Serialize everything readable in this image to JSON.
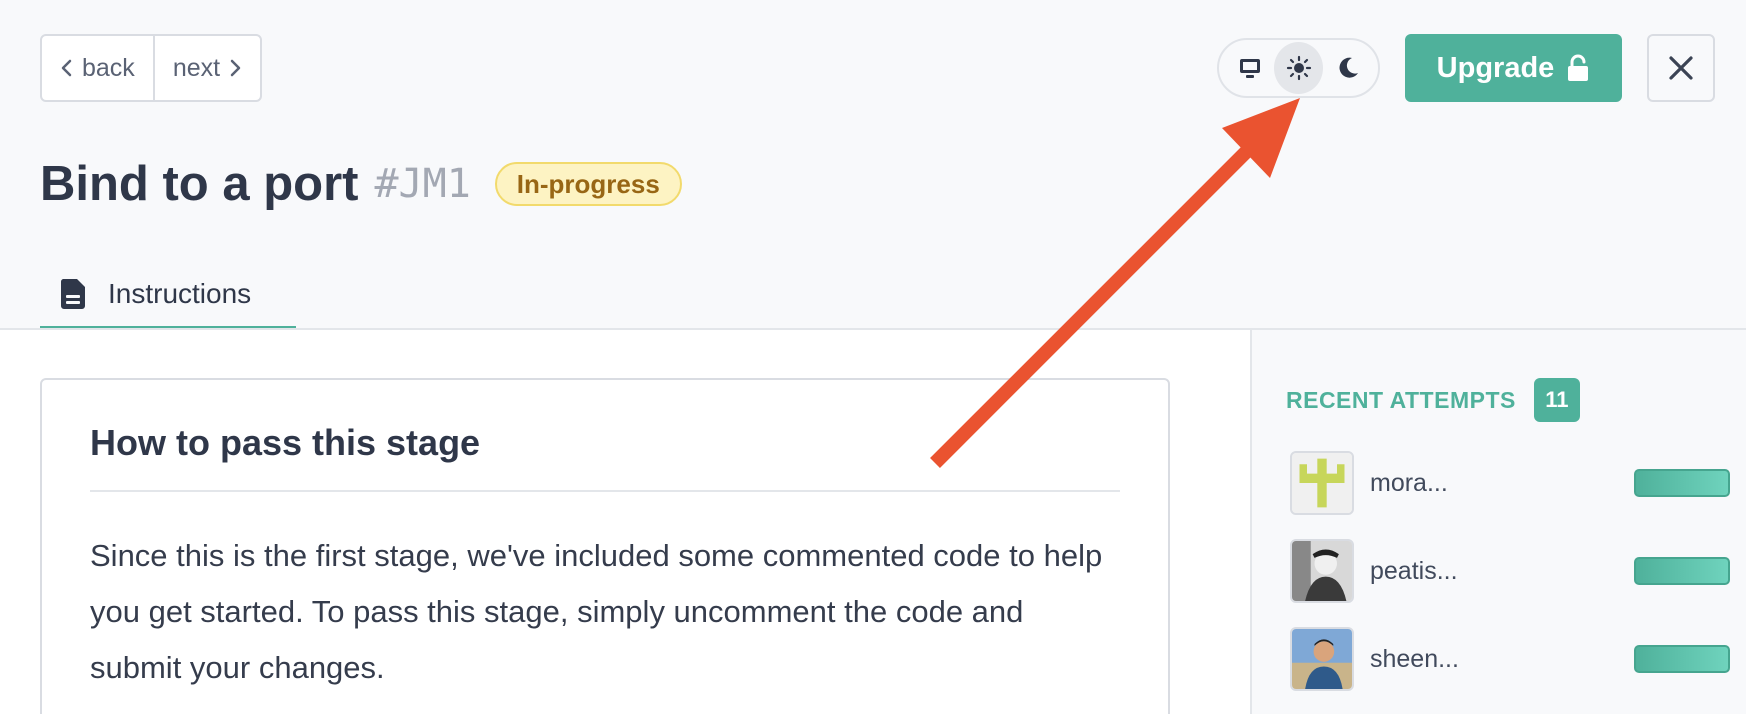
{
  "nav": {
    "back_label": "back",
    "next_label": "next"
  },
  "theme": {
    "options": [
      "monitor-icon",
      "sun-icon",
      "moon-icon"
    ],
    "selected": "sun-icon"
  },
  "upgrade": {
    "label": "Upgrade"
  },
  "stage": {
    "title": "Bind to a port",
    "code": "#JM1",
    "status": "In-progress"
  },
  "tabs": [
    {
      "label": "Instructions",
      "icon": "document-icon"
    }
  ],
  "card": {
    "title": "How to pass this stage",
    "text": "Since this is the first stage, we've included some commented code to help you get started. To pass this stage, simply uncomment the code and submit your changes."
  },
  "recent": {
    "label": "RECENT ATTEMPTS",
    "count": "11",
    "attempts": [
      {
        "username": "mora..."
      },
      {
        "username": "peatis..."
      },
      {
        "username": "sheen..."
      }
    ]
  },
  "colors": {
    "accent": "#4fb19b",
    "badge_bg": "#fdf3c3",
    "badge_text": "#986615",
    "arrow": "#ea5330"
  }
}
